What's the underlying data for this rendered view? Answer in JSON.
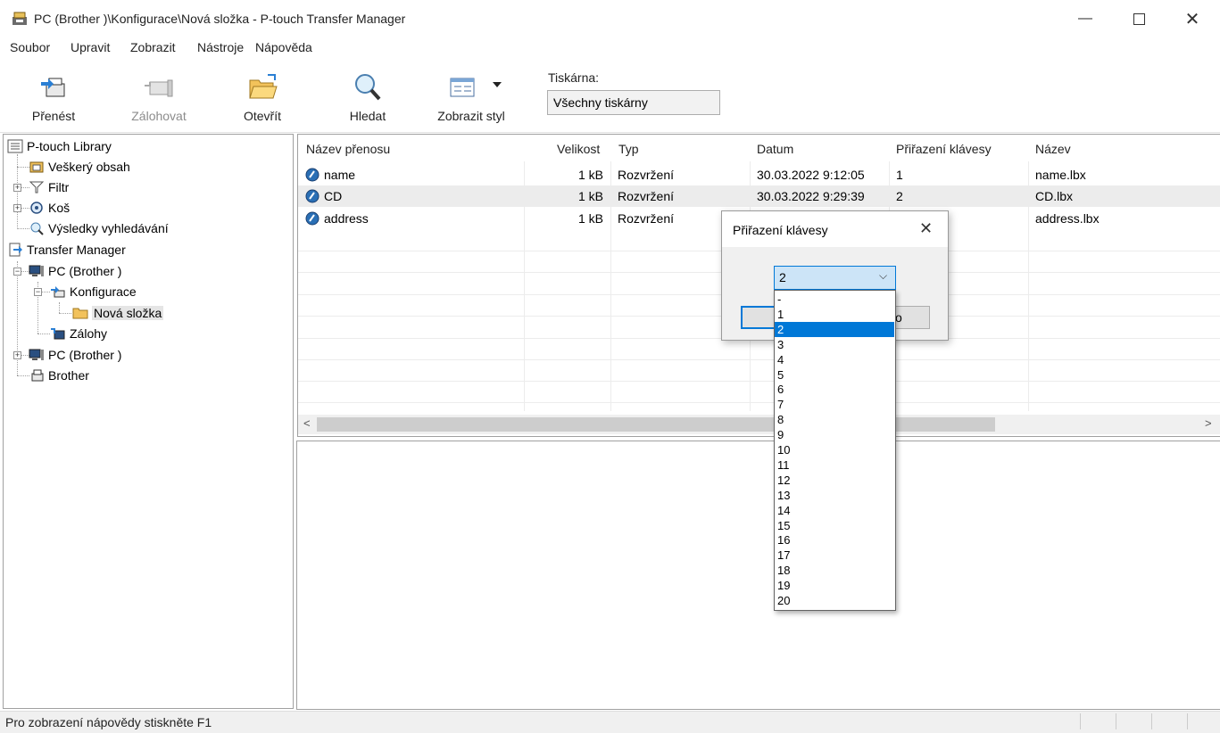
{
  "window": {
    "title": "PC (Brother                    )\\Konfigurace\\Nová složka - P-touch Transfer Manager"
  },
  "menu": [
    "Soubor",
    "Upravit",
    "Zobrazit",
    "Nástroje",
    "Nápověda"
  ],
  "toolbar": {
    "transfer": "Přenést",
    "backup": "Zálohovat",
    "open": "Otevřít",
    "search": "Hledat",
    "view_style": "Zobrazit styl",
    "printer_label": "Tiskárna:",
    "printer_value": "Všechny tiskárny"
  },
  "tree": {
    "library": "P-touch Library",
    "all_content": "Veškerý obsah",
    "filter": "Filtr",
    "trash": "Koš",
    "search_results": "Výsledky vyhledávání",
    "transfer_manager": "Transfer Manager",
    "pc1": "PC (Brother                )",
    "config": "Konfigurace",
    "new_folder": "Nová složka",
    "backups": "Zálohy",
    "pc2": "PC (Brother            )",
    "brother": "Brother"
  },
  "list": {
    "headers": [
      "Název přenosu",
      "Velikost",
      "Typ",
      "Datum",
      "Přiřazení klávesy",
      "Název"
    ],
    "rows": [
      {
        "name": "name",
        "size": "1 kB",
        "type": "Rozvržení",
        "date": "30.03.2022 9:12:05",
        "key": "1",
        "file": "name.lbx"
      },
      {
        "name": "CD",
        "size": "1 kB",
        "type": "Rozvržení",
        "date": "30.03.2022 9:29:39",
        "key": "2",
        "file": "CD.lbx"
      },
      {
        "name": "address",
        "size": "1 kB",
        "type": "Rozvržení",
        "date": "",
        "key": "",
        "file": "address.lbx"
      }
    ]
  },
  "dialog": {
    "title": "Přiřazení klávesy",
    "combo_value": "2",
    "button_text_partial": "o",
    "options": [
      "-",
      "1",
      "2",
      "3",
      "4",
      "5",
      "6",
      "7",
      "8",
      "9",
      "10",
      "11",
      "12",
      "13",
      "14",
      "15",
      "16",
      "17",
      "18",
      "19",
      "20"
    ],
    "selected": "2"
  },
  "status": {
    "text": "Pro zobrazení nápovědy stiskněte F1"
  },
  "colors": {
    "accent": "#0078d7",
    "selection_row": "#ececec"
  }
}
